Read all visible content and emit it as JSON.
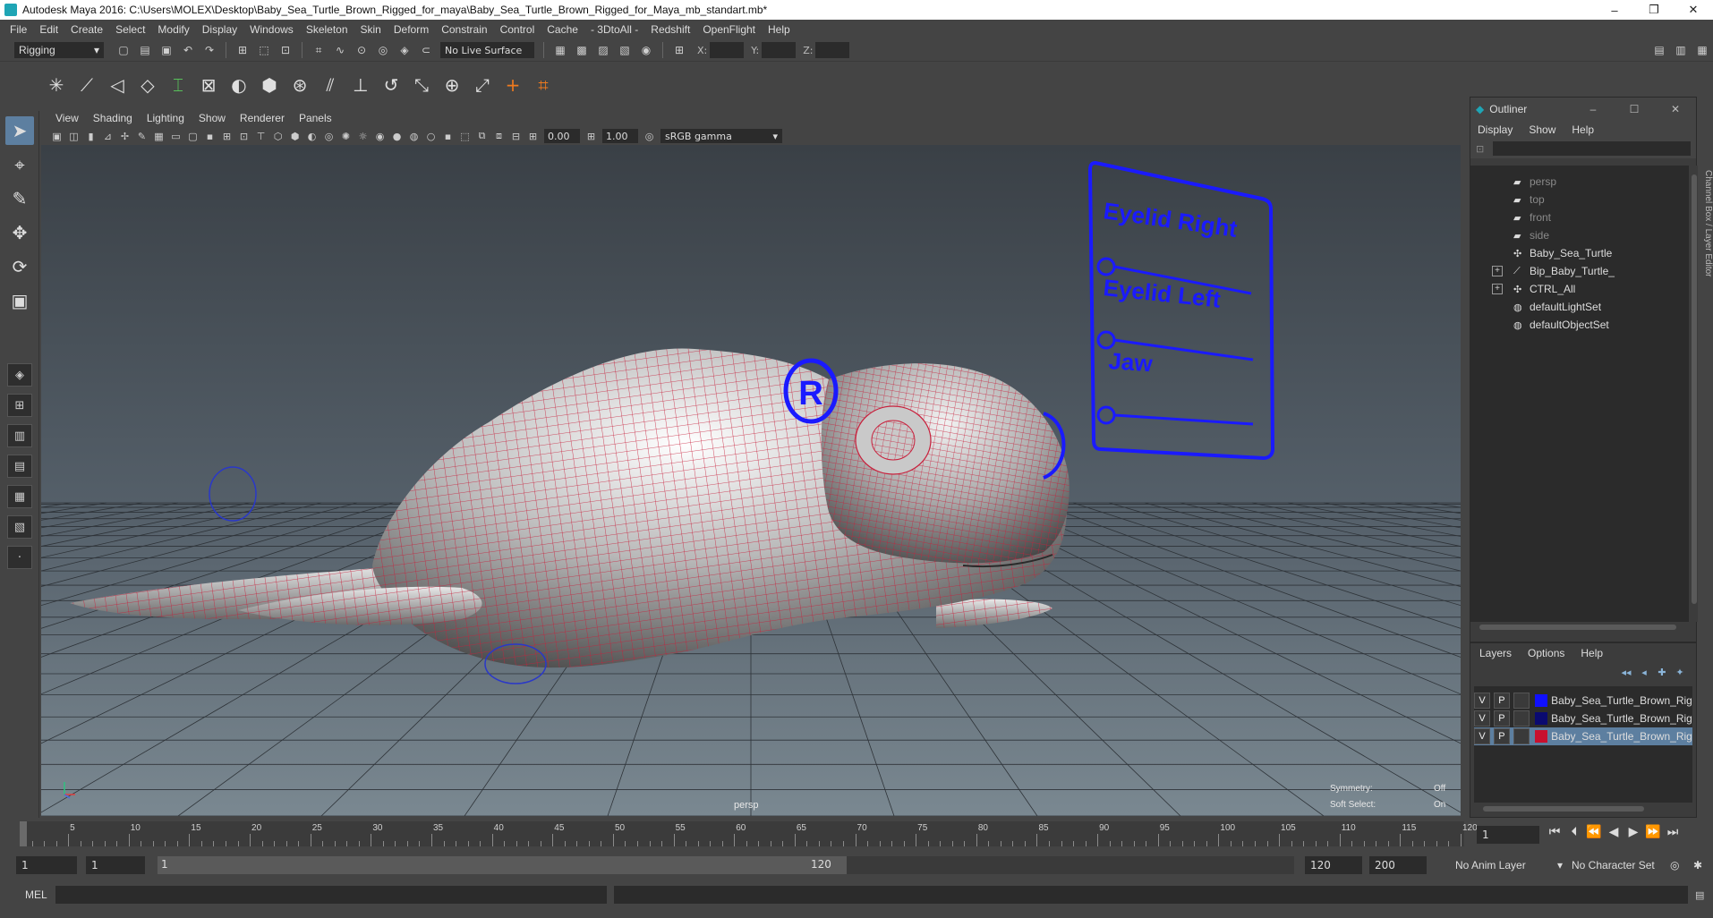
{
  "window": {
    "title": "Autodesk Maya 2016: C:\\Users\\MOLEX\\Desktop\\Baby_Sea_Turtle_Brown_Rigged_for_maya\\Baby_Sea_Turtle_Brown_Rigged_for_Maya_mb_standart.mb*",
    "controls": [
      "–",
      "❐",
      "✕"
    ]
  },
  "menubar": [
    "File",
    "Edit",
    "Create",
    "Select",
    "Modify",
    "Display",
    "Windows",
    "Skeleton",
    "Skin",
    "Deform",
    "Constrain",
    "Control",
    "Cache",
    "- 3DtoAll -",
    "Redshift",
    "OpenFlight",
    "Help"
  ],
  "statusline": {
    "mode": "Rigging",
    "live_surface": "No Live Surface",
    "x_label": "X:",
    "y_label": "Y:",
    "z_label": "Z:"
  },
  "panel": {
    "menus": [
      "View",
      "Shading",
      "Lighting",
      "Show",
      "Renderer",
      "Panels"
    ],
    "exposure": "0.00",
    "gamma": "1.00",
    "color_space": "sRGB gamma"
  },
  "viewport": {
    "camera": "persp",
    "symmetry_label": "Symmetry:",
    "symmetry_value": "Off",
    "soft_select_label": "Soft Select:",
    "soft_select_value": "On",
    "control_board": {
      "labels": [
        "Eyelid Right",
        "Eyelid Left",
        "Jaw"
      ],
      "r_marker": "R"
    }
  },
  "outliner": {
    "title": "Outliner",
    "menus": [
      "Display",
      "Show",
      "Help"
    ],
    "items": [
      {
        "label": "persp",
        "icon": "camera-icon",
        "dim": true,
        "expandable": false
      },
      {
        "label": "top",
        "icon": "camera-icon",
        "dim": true,
        "expandable": false
      },
      {
        "label": "front",
        "icon": "camera-icon",
        "dim": true,
        "expandable": false
      },
      {
        "label": "side",
        "icon": "camera-icon",
        "dim": true,
        "expandable": false
      },
      {
        "label": "Baby_Sea_Turtle",
        "icon": "transform-icon",
        "dim": false,
        "expandable": false
      },
      {
        "label": "Bip_Baby_Turtle_",
        "icon": "joint-icon",
        "dim": false,
        "expandable": true
      },
      {
        "label": "CTRL_All",
        "icon": "transform-icon",
        "dim": false,
        "expandable": true
      },
      {
        "label": "defaultLightSet",
        "icon": "set-icon",
        "dim": false,
        "expandable": false
      },
      {
        "label": "defaultObjectSet",
        "icon": "set-icon",
        "dim": false,
        "expandable": false
      }
    ]
  },
  "layer_editor": {
    "menus": [
      "Layers",
      "Options",
      "Help"
    ],
    "layers": [
      {
        "v": "V",
        "p": "P",
        "color": "#1010ff",
        "name": "Baby_Sea_Turtle_Brown_Rigged",
        "selected": false
      },
      {
        "v": "V",
        "p": "P",
        "color": "#0a0a70",
        "name": "Baby_Sea_Turtle_Brown_Rigged",
        "selected": false
      },
      {
        "v": "V",
        "p": "P",
        "color": "#c8102e",
        "name": "Baby_Sea_Turtle_Brown_Rigged",
        "selected": true
      }
    ]
  },
  "timeline": {
    "ticks": [
      "1",
      "5",
      "10",
      "15",
      "20",
      "25",
      "30",
      "35",
      "40",
      "45",
      "50",
      "55",
      "60",
      "65",
      "70",
      "75",
      "80",
      "85",
      "90",
      "95",
      "100",
      "105",
      "110",
      "115",
      "120"
    ],
    "current_frame": "1"
  },
  "range": {
    "start": "1",
    "playback_start": "1",
    "slider_left": "1",
    "slider_right": "120",
    "playback_end": "120",
    "end": "200",
    "anim_layer": "No Anim Layer",
    "character_set": "No Character Set"
  },
  "cmdline": {
    "lang": "MEL"
  },
  "colors": {
    "wire": "#c8203c",
    "control": "#1a1aff",
    "selection": "#5d7fa0"
  }
}
